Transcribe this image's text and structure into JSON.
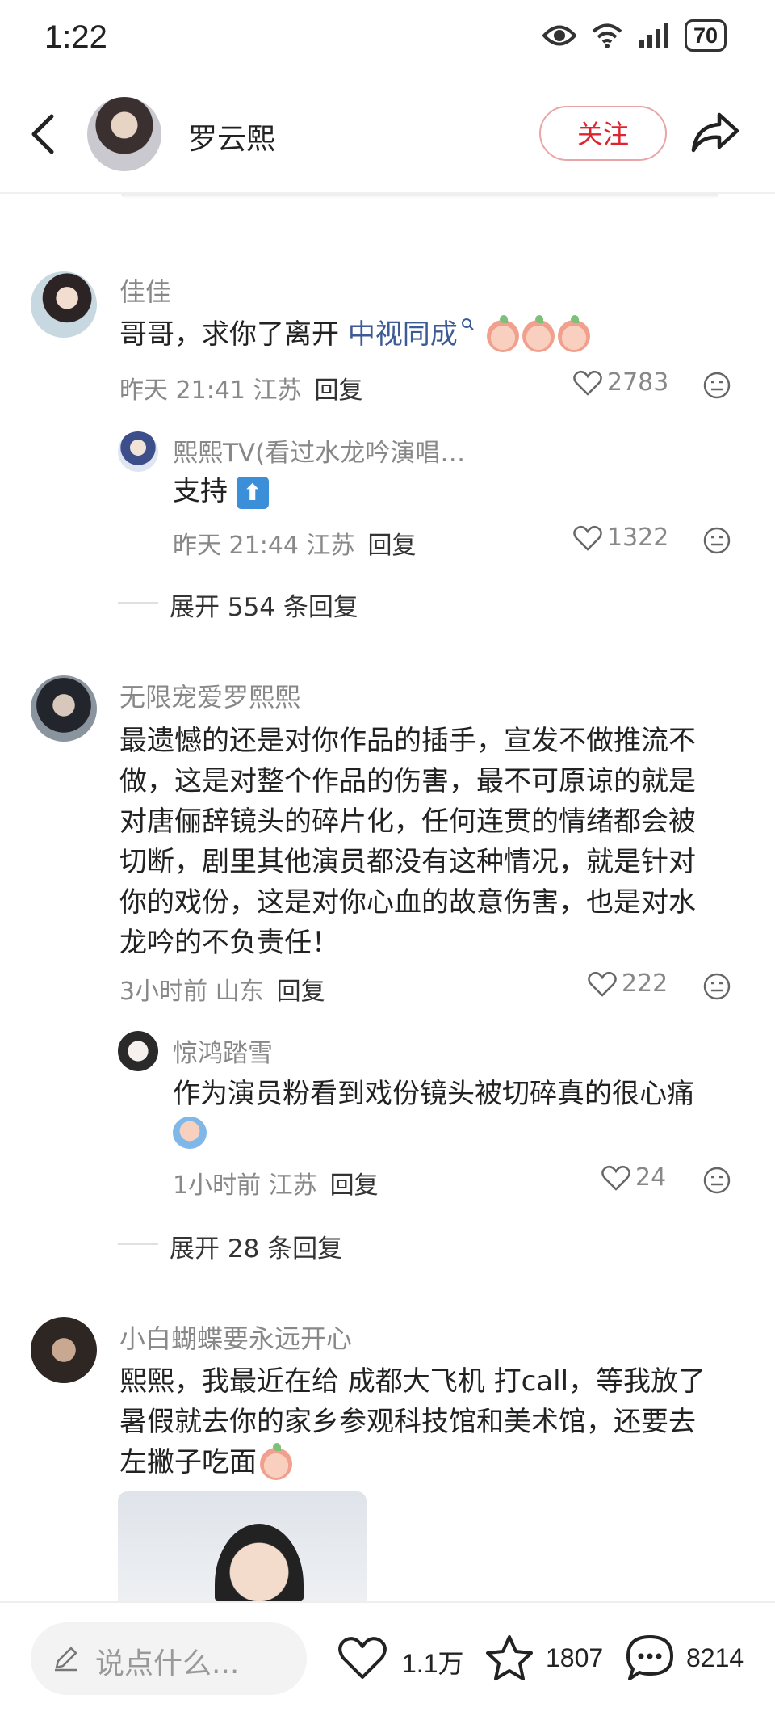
{
  "status_bar": {
    "time": "1:22",
    "battery": "70"
  },
  "header": {
    "username": "罗云熙",
    "follow_label": "关注"
  },
  "comments": [
    {
      "username": "佳佳",
      "text_before_link": "哥哥，求你了离开 ",
      "link_text": "中视同成",
      "meta": "昨天 21:41 江苏",
      "reply_label": "回复",
      "likes": "2783",
      "reply": {
        "username": "熙熙TV(看过水龙吟演唱…",
        "text": "支持",
        "meta": "昨天 21:44 江苏",
        "reply_label": "回复",
        "likes": "1322"
      },
      "expand_label": "展开 554 条回复"
    },
    {
      "username": "无限宠爱罗熙熙",
      "text_lines": [
        "最遗憾的还是对你作品的插手，宣发不做推流不",
        "做，这是对整个作品的伤害，最不可原谅的就是",
        "对唐俪辞镜头的碎片化，任何连贯的情绪都会被",
        "切断，剧里其他演员都没有这种情况，就是针对",
        "你的戏份，这是对你心血的故意伤害，也是对水",
        "龙吟的不负责任！"
      ],
      "meta": "3小时前 山东",
      "reply_label": "回复",
      "likes": "222",
      "reply": {
        "username": "惊鸿踏雪",
        "text": "作为演员粉看到戏份镜头被切碎真的很心痛",
        "meta": "1小时前 江苏",
        "reply_label": "回复",
        "likes": "24"
      },
      "expand_label": "展开 28 条回复"
    },
    {
      "username": "小白蝴蝶要永远开心",
      "text_lines": [
        "熙熙，我最近在给 成都大飞机 打call，等我放了",
        "暑假就去你的家乡参观科技馆和美术馆，还要去",
        "左撇子吃面"
      ]
    }
  ],
  "bottom_bar": {
    "input_placeholder": "说点什么...",
    "likes": "1.1万",
    "favorites": "1807",
    "comments": "8214"
  }
}
